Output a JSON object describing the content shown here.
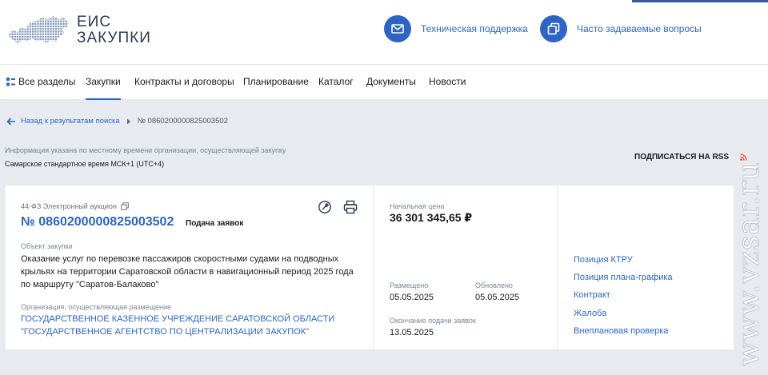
{
  "header": {
    "logo_line1": "ЕИС",
    "logo_line2": "ЗАКУПКИ",
    "support_label": "Техническая поддержка",
    "faq_label": "Часто задаваемые вопросы"
  },
  "nav": [
    {
      "label": "Все разделы",
      "active": false
    },
    {
      "label": "Закупки",
      "active": true
    },
    {
      "label": "Контракты и договоры",
      "active": false
    },
    {
      "label": "Планирование",
      "active": false
    },
    {
      "label": "Каталог",
      "active": false
    },
    {
      "label": "Документы",
      "active": false
    },
    {
      "label": "Новости",
      "active": false
    }
  ],
  "breadcrumb": {
    "back_label": "Назад к результатам поиска",
    "current": "№ 0860200000825003502"
  },
  "notice": {
    "info": "Информация указана по местному времени организации, осуществляющей закупку",
    "timezone": "Самарское стандартное время МСК+1 (UTC+4)",
    "rss_label": "ПОДПИСАТЬСЯ НА RSS"
  },
  "purchase": {
    "procedure_type": "44-ФЗ Электронный аукцион",
    "reg_number": "№ 0860200000825003502",
    "stage": "Подача заявок",
    "object_label": "Объект закупки",
    "object_lines": [
      "Оказание услуг по перевозке пассажиров скоростными судами на подводных",
      "крыльях на территории Саратовской области в навигационный период 2025 года",
      "по маршруту \"Саратов-Балаково\""
    ],
    "org_label": "Организация, осуществляющая размещение",
    "org_lines": [
      "ГОСУДАРСТВЕННОЕ КАЗЕННОЕ УЧРЕЖДЕНИЕ САРАТОВСКОЙ ОБЛАСТИ",
      "\"ГОСУДАРСТВЕННОЕ АГЕНТСТВО ПО ЦЕНТРАЛИЗАЦИИ ЗАКУПОК\""
    ],
    "price_label": "Начальная цена",
    "price": "36 301 345,65 ₽",
    "posted_label": "Размещено",
    "posted": "05.05.2025",
    "updated_label": "Обновлено",
    "updated": "05.05.2025",
    "deadline_label": "Окончание подачи заявок",
    "deadline": "13.05.2025"
  },
  "side_links": [
    "Позиция КТРУ",
    "Позиция плана-графика",
    "Контракт",
    "Жалоба",
    "Внеплановая проверка"
  ],
  "watermark": "www.vzsar.ru",
  "colors": {
    "accent": "#2c64c8",
    "page_bg": "#e7eaee",
    "header_text": "#2c3a55",
    "rss": "#e04a2a"
  }
}
